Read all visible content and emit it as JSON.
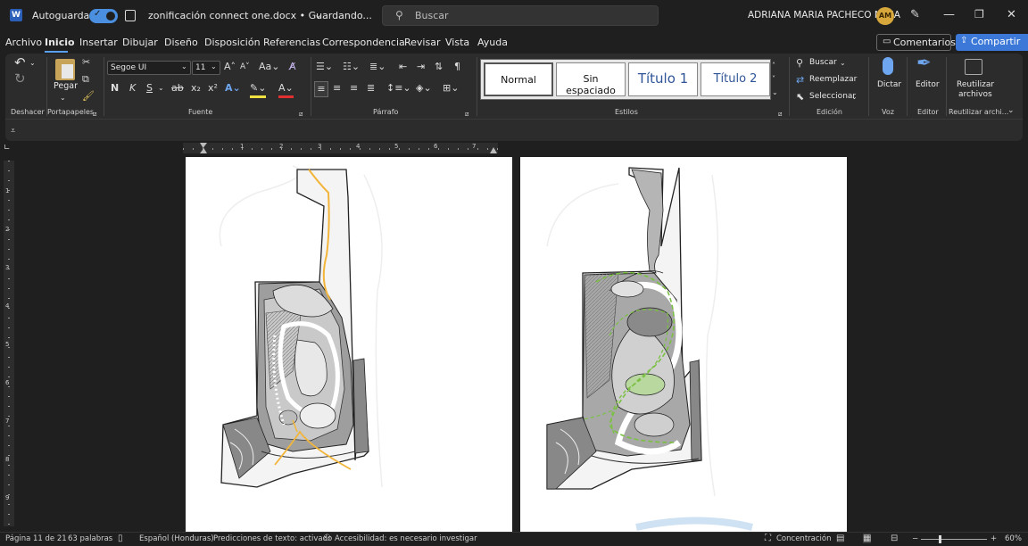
{
  "titlebar": {
    "autosave_label": "Autoguardado",
    "doc_title": "zonificación connect one.docx • Guardando...",
    "search_placeholder": "Buscar",
    "user_name": "ADRIANA MARIA PACHECO MEJIA",
    "user_initials": "AM"
  },
  "menu": {
    "items": [
      "Archivo",
      "Inicio",
      "Insertar",
      "Dibujar",
      "Diseño",
      "Disposición",
      "Referencias",
      "Correspondencia",
      "Revisar",
      "Vista",
      "Ayuda"
    ],
    "comments_label": "Comentarios",
    "share_label": "Compartir"
  },
  "ribbon": {
    "undo_group": "Deshacer",
    "clipboard": {
      "paste_label": "Pegar",
      "group": "Portapapeles"
    },
    "font": {
      "name": "Segoe UI",
      "size": "11",
      "group": "Fuente",
      "bold": "N",
      "italic": "K",
      "underline": "S"
    },
    "paragraph": {
      "group": "Párrafo"
    },
    "styles": {
      "items": [
        "Normal",
        "Sin espaciado",
        "Título 1",
        "Título 2"
      ],
      "group": "Estilos"
    },
    "editing": {
      "find": "Buscar",
      "replace": "Reemplazar",
      "select": "Seleccionar",
      "group": "Edición"
    },
    "voice": {
      "dictate": "Dictar",
      "group": "Voz"
    },
    "editor": {
      "label": "Editor",
      "group": "Editor"
    },
    "reuse": {
      "label_line1": "Reutilizar",
      "label_line2": "archivos",
      "group": "Reutilizar archi..."
    }
  },
  "ruler": {
    "marks": [
      "1",
      "2",
      "3",
      "4",
      "5",
      "6",
      "7"
    ],
    "vmarks": [
      "1",
      "2",
      "3",
      "4",
      "5",
      "6",
      "7",
      "8",
      "9"
    ]
  },
  "status": {
    "page": "Página 11 de 21",
    "words": "63 palabras",
    "language": "Español (Honduras)",
    "predictions": "Predicciones de texto: activado",
    "accessibility": "Accesibilidad: es necesario investigar",
    "focus": "Concentración",
    "zoom": "60%"
  },
  "colors": {
    "accent": "#3b78d8",
    "toggle": "#4a8fe0",
    "avatar": "#d7a73c",
    "path_orange": "#f2b53a",
    "path_green": "#7bc043"
  }
}
